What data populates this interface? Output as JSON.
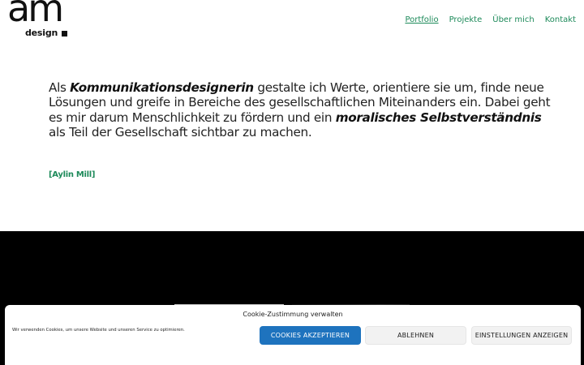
{
  "logo": {
    "mark": "am",
    "subtitle": "design"
  },
  "nav": {
    "items": [
      {
        "label": "Portfolio",
        "active": true
      },
      {
        "label": "Projekte",
        "active": false
      },
      {
        "label": "Über mich",
        "active": false
      },
      {
        "label": "Kontakt",
        "active": false
      }
    ]
  },
  "intro": {
    "p1": "Als ",
    "b1": "Kommunikationsdesignerin",
    "p2": " gestalte ich Werte, orientiere sie um, finde neue Lösungen und greife in Bereiche des gesellschaftlichen Miteinanders ein. Dabei geht es mir darum Menschlichkeit zu fördern und ein ",
    "b2": "moralisches Selbstverständnis",
    "p3": " als Teil der Gesellschaft sichtbar zu machen."
  },
  "author": "[Aylin Mill]",
  "cookie": {
    "title": "Cookie-Zustimmung verwalten",
    "text": "Wir verwenden Cookies, um unsere Website und unseren Service zu optimieren.",
    "accept": "COOKIES AKZEPTIEREN",
    "deny": "ABLEHNEN",
    "settings": "EINSTELLUNGEN ANZEIGEN"
  },
  "colors": {
    "accent": "#1d8a5a",
    "button_primary": "#1e73be",
    "band": "#000000"
  }
}
